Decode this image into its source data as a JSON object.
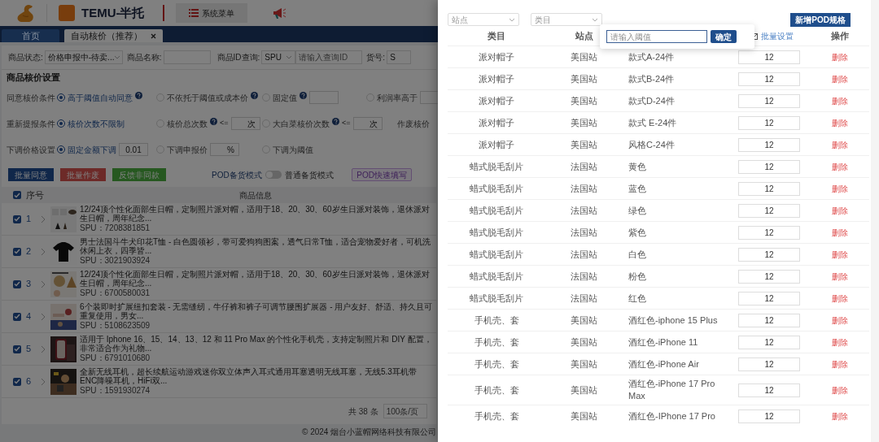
{
  "header": {
    "title": "TEMU-半托",
    "menu_button": "系统菜单"
  },
  "tabs": [
    {
      "label": "首页",
      "selected": false,
      "closable": false
    },
    {
      "label": "自动核价（推荐）",
      "selected": true,
      "closable": true
    }
  ],
  "filters": [
    {
      "kind": "select",
      "label": "商品状态:",
      "value": "价格申报中-待卖..."
    },
    {
      "kind": "input",
      "label": "商品名称:"
    },
    {
      "kind": "select_input",
      "label": "商品ID查询:",
      "value": "SPU",
      "placeholder": "请输入查询ID"
    },
    {
      "kind": "input",
      "label": "货号:",
      "value": "S"
    }
  ],
  "settings": {
    "title": "商品核价设置",
    "rows": [
      {
        "label": "同意核价条件",
        "options": [
          {
            "kind": "radio",
            "label": "高于阈值自动同意",
            "selected": true,
            "help": true
          },
          {
            "kind": "radio",
            "label": "不依托于阈值或成本价",
            "selected": false,
            "help": true
          },
          {
            "kind": "radio",
            "label": "固定值",
            "selected": false,
            "help": true,
            "has_field": true
          },
          {
            "kind": "radio",
            "label": "利润率高于",
            "selected": false,
            "has_field": true
          }
        ]
      },
      {
        "label": "重新提报条件",
        "options": [
          {
            "kind": "radio",
            "label": "核价次数不限制",
            "selected": true
          },
          {
            "kind": "radio",
            "label": "核价总次数",
            "selected": false,
            "help": true,
            "prefix": "<=",
            "has_field": true,
            "unit": "次"
          },
          {
            "kind": "radio",
            "label": "大白菜核价次数",
            "selected": false,
            "help": true,
            "prefix": "<=",
            "has_field": true,
            "unit": "次"
          },
          {
            "kind": "label",
            "label": "作废核价"
          }
        ]
      },
      {
        "label": "下调价格设置",
        "options": [
          {
            "kind": "radio",
            "label": "固定金额下调",
            "selected": true,
            "has_field": true,
            "value": "0.01"
          },
          {
            "kind": "radio",
            "label": "下调申报价",
            "selected": false,
            "has_field": true,
            "unit": "%"
          },
          {
            "kind": "radio",
            "label": "下调为阈值",
            "selected": false
          }
        ]
      }
    ]
  },
  "actions": {
    "buttons": [
      {
        "label": "批量同意",
        "color": "#10274a"
      },
      {
        "label": "批量作废",
        "color": "#6d2a28"
      },
      {
        "label": "反馈非同款",
        "color": "#265820"
      }
    ],
    "mode_switch": {
      "left_label": "POD备货模式",
      "right_label": "普通备货模式",
      "on": false
    },
    "quick_button": "POD快速填写"
  },
  "table": {
    "header_checked": true,
    "columns": [
      "序号",
      "商品信息"
    ],
    "rows": [
      {
        "index": "1",
        "checked": true,
        "title": "12/24顶个性化面部生日帽，定制照片派对帽，适用于18、20、30、60岁生日派对装饰，退休派对生日帽，周年纪念...",
        "spu": "SPU：7208381851"
      },
      {
        "index": "2",
        "checked": true,
        "title": "男士法国斗牛犬印花T恤 - 白色圆领衫，带可爱狗狗图案，透气日常T恤，适合宠物爱好者，可机洗休闲上衣，四季皆...",
        "spu": "SPU：3021903924"
      },
      {
        "index": "3",
        "checked": true,
        "title": "12/24顶个性化面部生日帽，定制照片派对帽，适用于18、20、30、60岁生日派对装饰，退休派对生日帽，周年纪念...",
        "spu": "SPU：6700580031"
      },
      {
        "index": "4",
        "checked": true,
        "title": "6个装即时扩展纽扣套装 - 无需缝纫，牛仔裤和裤子可调节腰围扩展器 - 用户友好、舒适、持久且可重复使用，男女...",
        "spu": "SPU：5108623509"
      },
      {
        "index": "5",
        "checked": true,
        "title": "适用于 Iphone 16、15、14、13、12 和 11 Pro Max 的个性化手机壳，支持定制照片和 DIY 配置，非常适合作为礼物...",
        "spu": "SPU：6791010680"
      },
      {
        "index": "6",
        "checked": true,
        "title": "全新无线耳机，超长续航运动游戏迷你双立体声入耳式通用耳塞透明无线耳塞，无线5.3耳机带ENC降噪耳机，HiFi双...",
        "spu": "SPU：1591930274"
      }
    ]
  },
  "pagination": {
    "total": "共 38 条",
    "page_size": "100条/页"
  },
  "footer": "© 2024 烟台小蓝帽网络科技有限公司",
  "drawer": {
    "filters": [
      {
        "placeholder": "站点"
      },
      {
        "placeholder": "类目"
      }
    ],
    "add_button": "新增POD规格",
    "popover": {
      "placeholder": "请输入阈值",
      "button": "确定"
    },
    "columns": {
      "category": "类目",
      "site": "站点",
      "batch": "批量设置",
      "action": "操作"
    },
    "rows": [
      {
        "category": "派对帽子",
        "site": "美国站",
        "spec": "款式A-24件",
        "value": "12",
        "action": "删除"
      },
      {
        "category": "派对帽子",
        "site": "美国站",
        "spec": "款式B-24件",
        "value": "12",
        "action": "删除"
      },
      {
        "category": "派对帽子",
        "site": "美国站",
        "spec": "款式D-24件",
        "value": "12",
        "action": "删除"
      },
      {
        "category": "派对帽子",
        "site": "美国站",
        "spec": "款式 E-24件",
        "value": "12",
        "action": "删除"
      },
      {
        "category": "派对帽子",
        "site": "美国站",
        "spec": "风格C-24件",
        "value": "12",
        "action": "删除"
      },
      {
        "category": "蜡式脱毛刮片",
        "site": "法国站",
        "spec": "黄色",
        "value": "12",
        "action": "删除"
      },
      {
        "category": "蜡式脱毛刮片",
        "site": "法国站",
        "spec": "蓝色",
        "value": "12",
        "action": "删除"
      },
      {
        "category": "蜡式脱毛刮片",
        "site": "法国站",
        "spec": "绿色",
        "value": "12",
        "action": "删除"
      },
      {
        "category": "蜡式脱毛刮片",
        "site": "法国站",
        "spec": "紫色",
        "value": "12",
        "action": "删除"
      },
      {
        "category": "蜡式脱毛刮片",
        "site": "法国站",
        "spec": "白色",
        "value": "12",
        "action": "删除"
      },
      {
        "category": "蜡式脱毛刮片",
        "site": "法国站",
        "spec": "粉色",
        "value": "12",
        "action": "删除"
      },
      {
        "category": "蜡式脱毛刮片",
        "site": "法国站",
        "spec": "红色",
        "value": "12",
        "action": "删除"
      },
      {
        "category": "手机壳、套",
        "site": "美国站",
        "spec": "酒红色-iphone 15 Plus",
        "value": "12",
        "action": "删除"
      },
      {
        "category": "手机壳、套",
        "site": "美国站",
        "spec": "酒红色-iPhone 11",
        "value": "12",
        "action": "删除"
      },
      {
        "category": "手机壳、套",
        "site": "美国站",
        "spec": "酒红色-iPhone Air",
        "value": "12",
        "action": "删除"
      },
      {
        "category": "手机壳、套",
        "site": "美国站",
        "spec": "酒红色-iPhone 17 Pro Max",
        "value": "12",
        "action": "删除"
      },
      {
        "category": "手机壳、套",
        "site": "美国站",
        "spec": "酒红色-IPhone 17 Pro",
        "value": "12",
        "action": "删除"
      }
    ]
  }
}
